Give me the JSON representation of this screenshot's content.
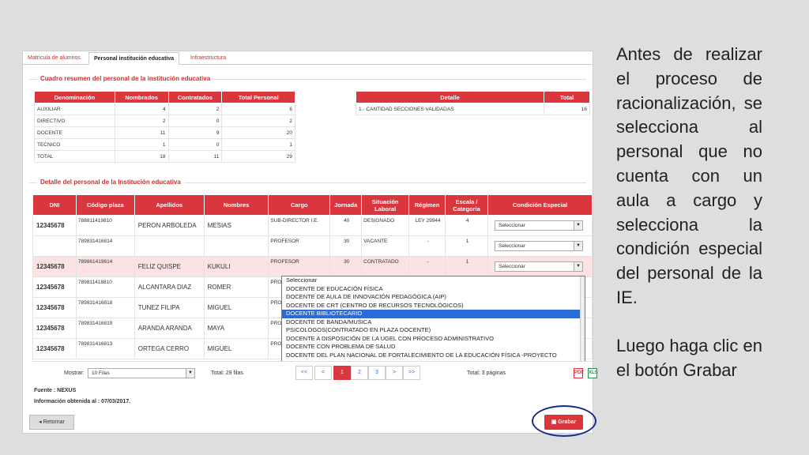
{
  "tabs": [
    "Matrícula de alumnos",
    "Personal institución educativa",
    "Infraestructura"
  ],
  "resumen": {
    "legend": "Cuadro resumen del personal de la institución educativa",
    "headers": [
      "Denominación",
      "Nombrados",
      "Contratados",
      "Total Personal"
    ],
    "rows": [
      [
        "AUXILIAR",
        "4",
        "2",
        "6"
      ],
      [
        "DIRECTIVO",
        "2",
        "0",
        "2"
      ],
      [
        "DOCENTE",
        "11",
        "9",
        "20"
      ],
      [
        "TECNICO",
        "1",
        "0",
        "1"
      ],
      [
        "TOTAL",
        "18",
        "11",
        "29"
      ]
    ]
  },
  "detalle_resumen": {
    "headers": [
      "Detalle",
      "Total"
    ],
    "rows": [
      [
        "1.- CANTIDAD SECCIONES VALIDADAS",
        "16"
      ]
    ]
  },
  "detalle": {
    "legend": "Detalle del personal de la Institución educativa",
    "headers": [
      "DNI",
      "Código plaza",
      "Apellidos",
      "Nombres",
      "Cargo",
      "Jornada",
      "Situación Laboral",
      "Régimen",
      "Escala / Categoria",
      "Condición Especial"
    ],
    "rows": [
      {
        "dni": "12345678",
        "codigo": "788811419810",
        "apellidos": "PERON  ARBOLEDA",
        "nombres": "MESIAS",
        "cargo": "SUB-DIRECTOR I.E.",
        "jornada": "40",
        "situacion": "DESIGNADO",
        "regimen": "LEY 29944",
        "escala": "4",
        "condicion": "Seleccionar"
      },
      {
        "dni": "",
        "codigo": "789831416814",
        "apellidos": "",
        "nombres": "",
        "cargo": "PROFESOR",
        "jornada": "30",
        "situacion": "VACANTE",
        "regimen": "-",
        "escala": "1",
        "condicion": "Seleccionar"
      },
      {
        "dni": "12345678",
        "codigo": "789861419614",
        "apellidos": "FELIZ  QUISPE",
        "nombres": "KUKULI",
        "cargo": "PROFESOR",
        "jornada": "30",
        "situacion": "CONTRATADO",
        "regimen": "-",
        "escala": "1",
        "condicion": "Seleccionar"
      },
      {
        "dni": "12345678",
        "codigo": "789811418810",
        "apellidos": "ALCANTARA DIAZ",
        "nombres": "ROMER",
        "cargo": "PRO",
        "jornada": "",
        "situacion": "",
        "regimen": "",
        "escala": "",
        "condicion": ""
      },
      {
        "dni": "12345678",
        "codigo": "789831416818",
        "apellidos": "TUNEZ  FILIPA",
        "nombres": "MIGUEL",
        "cargo": "PRO",
        "jornada": "",
        "situacion": "",
        "regimen": "",
        "escala": "",
        "condicion": ""
      },
      {
        "dni": "12345678",
        "codigo": "789831416819",
        "apellidos": "ARANDA  ARANDA",
        "nombres": "MAYA",
        "cargo": "PRO",
        "jornada": "",
        "situacion": "",
        "regimen": "",
        "escala": "",
        "condicion": ""
      },
      {
        "dni": "12345678",
        "codigo": "789831416813",
        "apellidos": "ORTEGA  CERRO",
        "nombres": "MIGUEL",
        "cargo": "PRO",
        "jornada": "",
        "situacion": "",
        "regimen": "",
        "escala": "",
        "condicion": ""
      }
    ]
  },
  "dropdown": {
    "options": [
      "Seleccionar",
      "DOCENTE DE EDUCACIÓN FÍSICA",
      "DOCENTE DE AULA DE INNOVACIÓN PEDAGÓGICA (AIP)",
      "DOCENTE DE CRT (CENTRO DE RECURSOS TECNOLÓGICOS)",
      "DOCENTE BIBLIOTECARIO",
      "DOCENTE DE BANDA/MUSICA",
      "PSICOLOGOS(CONTRATADO EN PLAZA DOCENTE)",
      "DOCENTE A DISPOSICIÓN DE LA UGEL CON PROCESO ADMINISTRATIVO",
      "DOCENTE CON PROBLEMA DE SALUD",
      "DOCENTE DEL PLAN NACIONAL DE FORTALECIMIENTO DE LA EDUCACIÓN FÍSICA -PROYECTO"
    ],
    "selected_index": 4
  },
  "pager": {
    "mostrar_label": "Mostrar:",
    "mostrar_value": "10 Filas",
    "total_filas": "Total: 29 filas",
    "pages": [
      "<<",
      "<",
      "1",
      "2",
      "3",
      ">",
      ">>"
    ],
    "current": "1",
    "total_paginas": "Total: 3 páginas"
  },
  "footer": {
    "fuente": "Fuente : NEXUS",
    "info": "Información obtenida al : 07/03/2017."
  },
  "buttons": {
    "retornar": "Retornar",
    "grabar": "Grabar"
  },
  "icons": {
    "pdf": "PDF",
    "excel": "XLS"
  },
  "note": {
    "p1": "Antes de realizar el proceso de racionalización, se selecciona al personal que no cuenta con un aula a cargo y selecciona la condición especial del personal de la IE.",
    "p2": "Luego haga clic en el botón Grabar"
  }
}
